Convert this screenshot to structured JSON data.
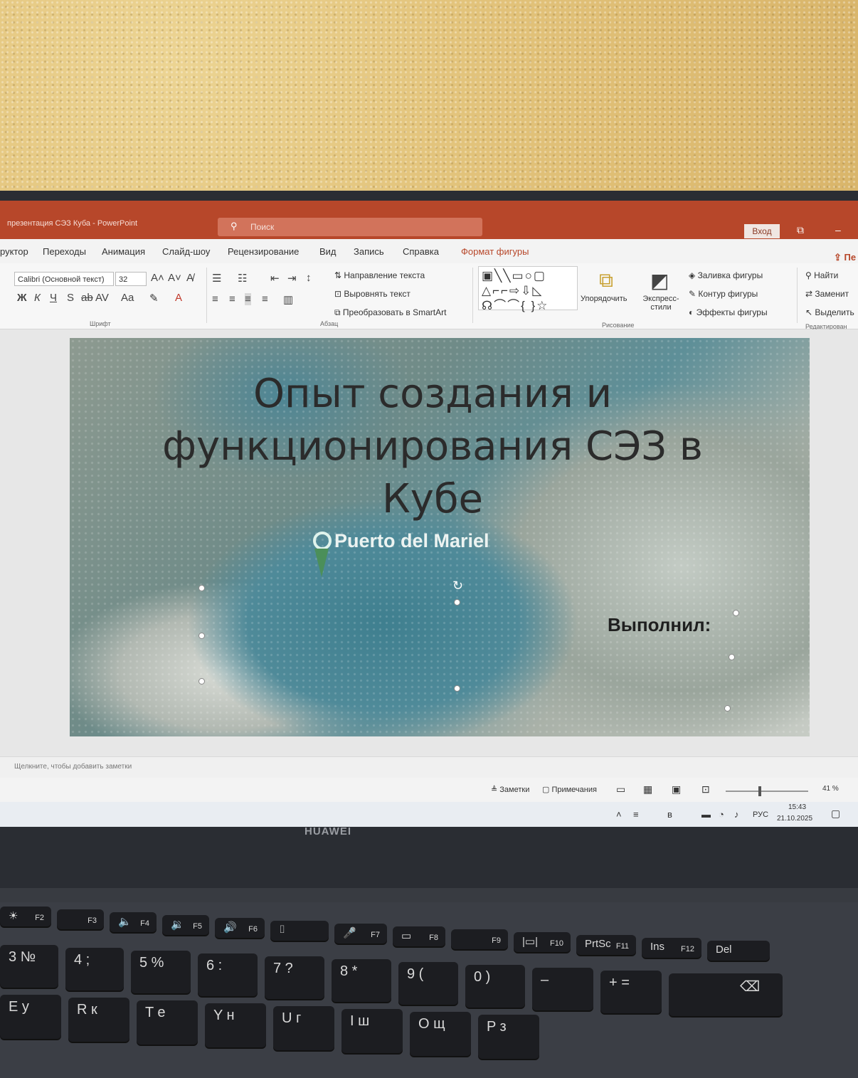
{
  "window": {
    "title": "презентация СЭЗ Куба - PowerPoint",
    "search_placeholder": "Поиск",
    "signin_label": "Вход"
  },
  "tabs": [
    "руктор",
    "Переходы",
    "Анимация",
    "Слайд-шоу",
    "Рецензирование",
    "Вид",
    "Запись",
    "Справка",
    "Формат фигуры"
  ],
  "share_label": "Пе",
  "ribbon": {
    "font_name": "Calibri (Основной текст)",
    "font_size": "32",
    "groups": {
      "font": "Шрифт",
      "paragraph": "Абзац",
      "drawing": "Рисование",
      "editing": "Редактирован"
    },
    "paragraph": {
      "text_direction": "Направление текста",
      "align_text": "Выровнять текст",
      "smartart": "Преобразовать в SmartArt"
    },
    "drawing": {
      "arrange": "Упорядочить",
      "quick_styles": "Экспресс-стили",
      "shape_fill": "Заливка фигуры",
      "shape_outline": "Контур фигуры",
      "shape_effects": "Эффекты фигуры"
    },
    "editing": {
      "find": "Найти",
      "replace": "Заменит",
      "select": "Выделить"
    }
  },
  "slide": {
    "title": "Опыт создания и функционирования СЭЗ в Кубе",
    "map_label": "Puerto del Mariel",
    "subtitle": "Выполнил:"
  },
  "notes_placeholder": "Щелкните, чтобы добавить заметки",
  "statusbar": {
    "notes_label": "Заметки",
    "comments_label": "Примечания",
    "zoom": "41 %"
  },
  "taskbar": {
    "language": "РУС",
    "time": "15:43",
    "date": "21.10.2025"
  },
  "laptop_brand": "HUAWEI",
  "keyboard": {
    "fn_row": [
      {
        "t": "☀",
        "f": "F2"
      },
      {
        "t": "",
        "f": "F3"
      },
      {
        "t": "🔈",
        "f": "F4"
      },
      {
        "t": "🔉",
        "f": "F5"
      },
      {
        "t": "🔊",
        "f": "F6"
      },
      {
        "t": "⌷",
        "f": ""
      },
      {
        "t": "🎤",
        "f": "F7"
      },
      {
        "t": "▭",
        "f": "F8"
      },
      {
        "t": "",
        "f": "F9"
      },
      {
        "t": "|▭|",
        "f": "F10"
      },
      {
        "t": "PrtSc",
        "f": "F11"
      },
      {
        "t": "Ins",
        "f": "F12"
      },
      {
        "t": "Del",
        "f": ""
      }
    ],
    "num_row": [
      "3 №",
      "4 ;",
      "5 %",
      "6 :",
      "7 ?",
      "8 *",
      "9 (",
      "0 )",
      "–",
      "+ ="
    ],
    "letter_row": [
      "E у",
      "R к",
      "T е",
      "Y н",
      "U г",
      "I ш",
      "O щ",
      "P з"
    ]
  }
}
